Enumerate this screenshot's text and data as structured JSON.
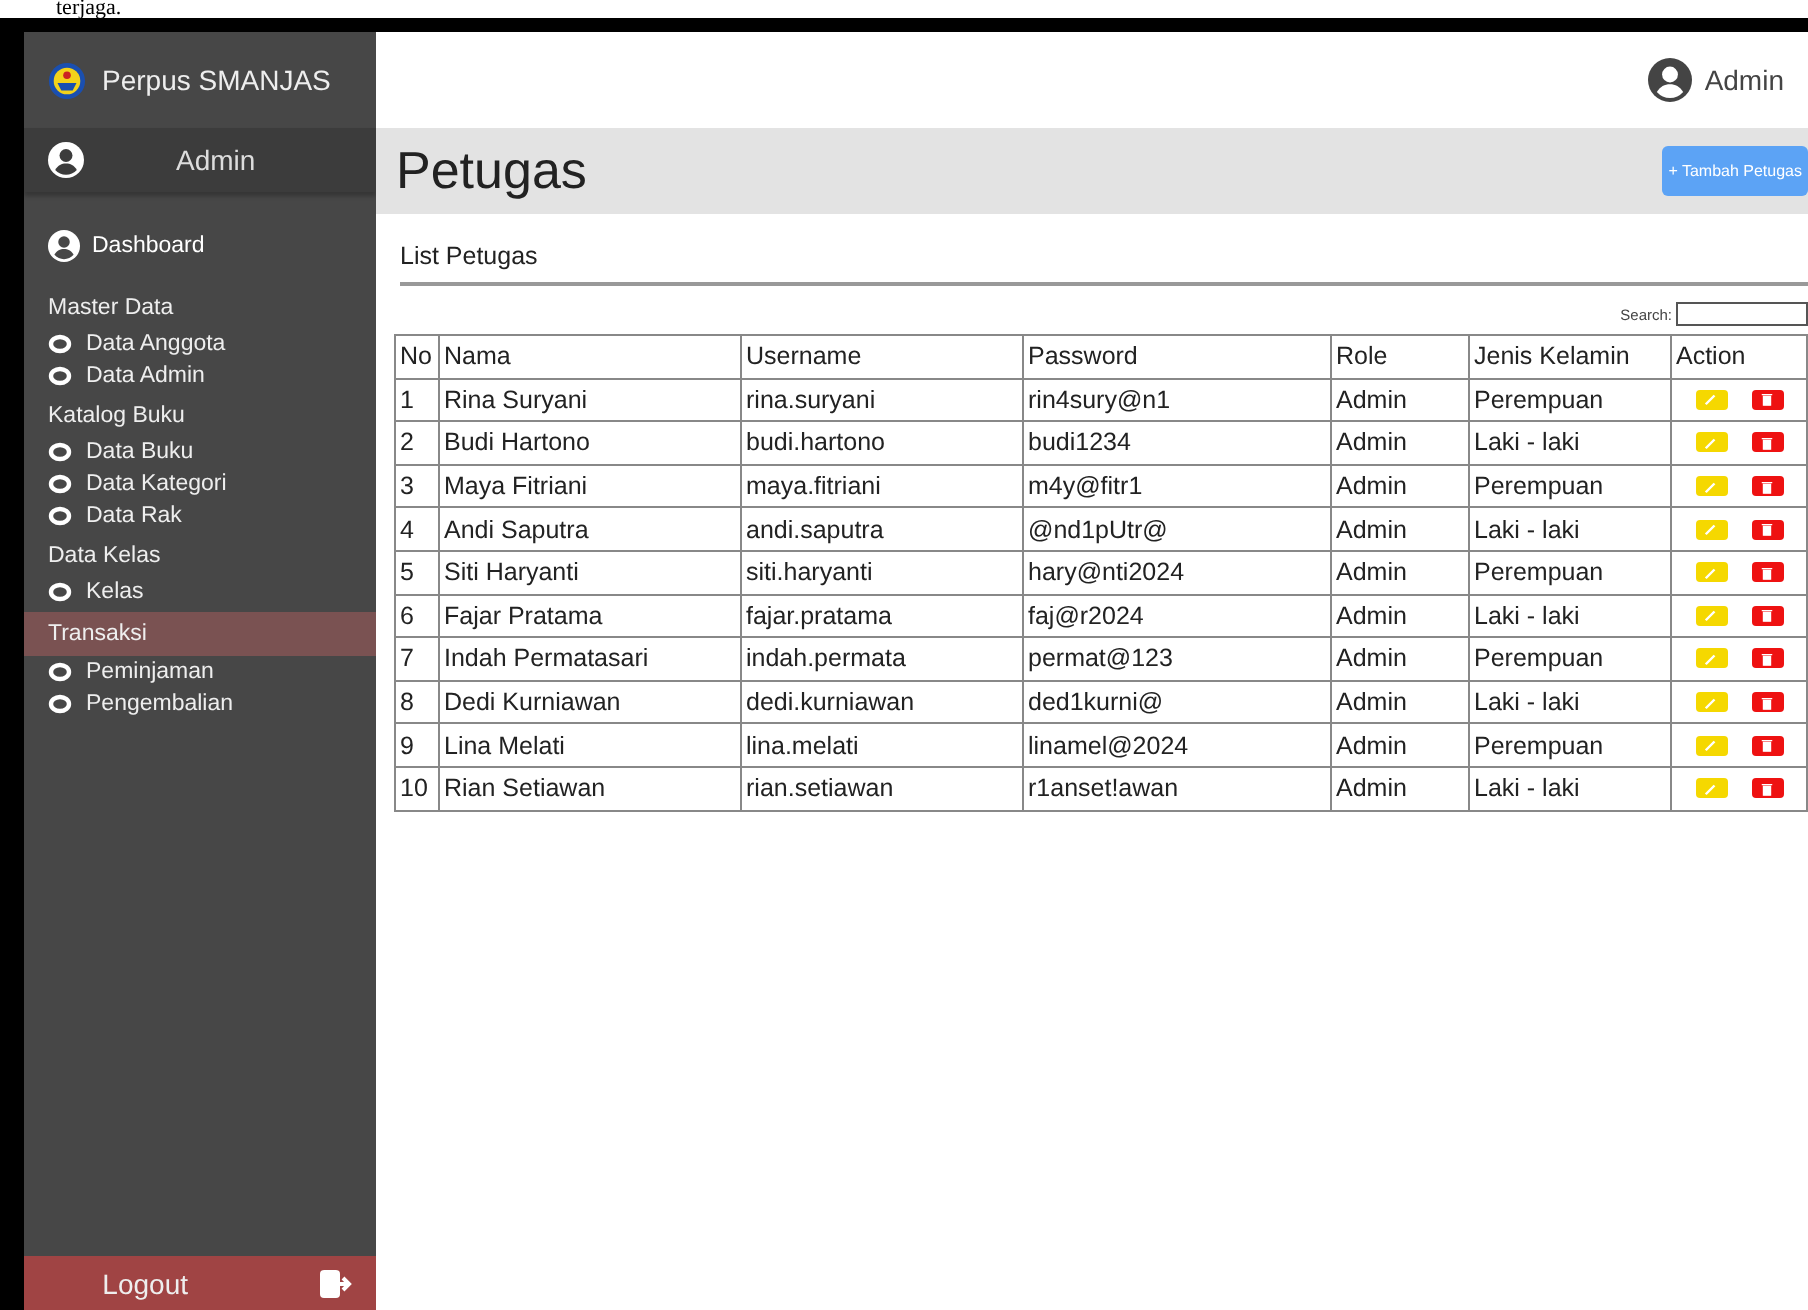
{
  "document_fragment": "terjaga.",
  "sidebar": {
    "brand": "Perpus SMANJAS",
    "user": "Admin",
    "nav": [
      {
        "kind": "link",
        "label": "Dashboard",
        "selected": false
      },
      {
        "kind": "group",
        "label": "Master Data",
        "selected": false,
        "children": [
          {
            "label": "Data Anggota",
            "selected": false
          },
          {
            "label": "Data Admin",
            "selected": false
          }
        ]
      },
      {
        "kind": "group",
        "label": "Katalog Buku",
        "selected": false,
        "children": [
          {
            "label": "Data Buku",
            "selected": false
          },
          {
            "label": "Data Kategori",
            "selected": false
          },
          {
            "label": "Data Rak",
            "selected": false
          }
        ]
      },
      {
        "kind": "group",
        "label": "Data Kelas",
        "selected": false,
        "children": [
          {
            "label": "Kelas",
            "selected": false
          }
        ]
      },
      {
        "kind": "group",
        "label": "Transaksi",
        "selected": true,
        "children": [
          {
            "label": "Peminjaman",
            "selected": false
          },
          {
            "label": "Pengembalian",
            "selected": false
          }
        ]
      }
    ],
    "logout": "Logout"
  },
  "topbar": {
    "user": "Admin"
  },
  "page": {
    "title": "Petugas",
    "add_button": "+ Tambah Petugas",
    "section": "List Petugas",
    "search_label": "Search:"
  },
  "table": {
    "columns": [
      "No",
      "Nama",
      "Username",
      "Password",
      "Role",
      "Jenis Kelamin",
      "Action"
    ],
    "rows": [
      [
        "1",
        "Rina Suryani",
        "rina.suryani",
        "rin4sury@n1",
        "Admin",
        "Perempuan"
      ],
      [
        "2",
        "Budi Hartono",
        "budi.hartono",
        "budi1234",
        "Admin",
        "Laki - laki"
      ],
      [
        "3",
        "Maya Fitriani",
        "maya.fitriani",
        "m4y@fitr1",
        "Admin",
        "Perempuan"
      ],
      [
        "4",
        "Andi Saputra",
        "andi.saputra",
        "@nd1pUtr@",
        "Admin",
        "Laki - laki"
      ],
      [
        "5",
        "Siti Haryanti",
        "siti.haryanti",
        "hary@nti2024",
        "Admin",
        "Perempuan"
      ],
      [
        "6",
        "Fajar Pratama",
        "fajar.pratama",
        "faj@r2024",
        "Admin",
        "Laki - laki"
      ],
      [
        "7",
        "Indah Permatasari",
        "indah.permata",
        "permat@123",
        "Admin",
        "Perempuan"
      ],
      [
        "8",
        "Dedi Kurniawan",
        "dedi.kurniawan",
        "ded1kurni@",
        "Admin",
        "Laki - laki"
      ],
      [
        "9",
        "Lina Melati",
        "lina.melati",
        "linamel@2024",
        "Admin",
        "Perempuan"
      ],
      [
        "10",
        "Rian Setiawan",
        "rian.setiawan",
        "r1anset!awan",
        "Admin",
        "Laki - laki"
      ]
    ]
  }
}
